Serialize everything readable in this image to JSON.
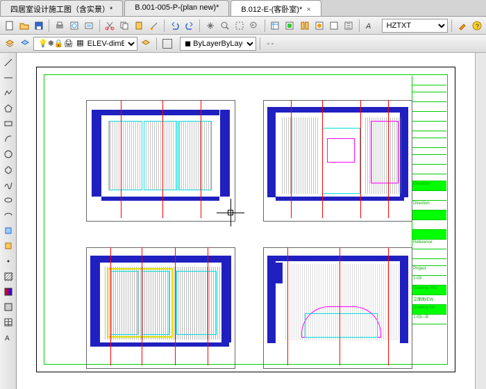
{
  "tabs": [
    {
      "label": "四居室设计施工图（含实景）*",
      "active": false
    },
    {
      "label": "B.001-005-P-(plan new)*",
      "active": false
    },
    {
      "label": "B.012-E-(客卧室)*",
      "active": true
    }
  ],
  "toolbar1": {
    "icons": [
      "new",
      "open",
      "save",
      "print",
      "preview",
      "cut",
      "copy",
      "paste",
      "match",
      "undo",
      "redo",
      "pan",
      "zoom",
      "zoomext",
      "prop",
      "sheet",
      "block",
      "tool",
      "help"
    ]
  },
  "toolbar2": {
    "layer_name": "ELEV-dim",
    "text_style": "HZTXT",
    "linetype": "ByLayer"
  },
  "side_tools": [
    "line",
    "pline",
    "polygon",
    "rect",
    "arc",
    "circle",
    "spline",
    "ellipse",
    "earc",
    "point",
    "hatch",
    "region",
    "table",
    "mtext",
    "wipeout",
    "rev"
  ],
  "title_block": {
    "rows": [
      {
        "label": "",
        "cls": ""
      },
      {
        "label": "",
        "cls": "blank"
      },
      {
        "label": "",
        "cls": ""
      },
      {
        "label": "",
        "cls": ""
      },
      {
        "label": "",
        "cls": ""
      },
      {
        "label": "",
        "cls": ""
      },
      {
        "label": "",
        "cls": "blank"
      },
      {
        "label": "",
        "cls": ""
      },
      {
        "label": "",
        "cls": "blank"
      },
      {
        "label": "",
        "cls": ""
      },
      {
        "label": "",
        "cls": ""
      },
      {
        "label": "",
        "cls": "blank"
      },
      {
        "label": "Elevation",
        "cls": "green"
      },
      {
        "label": "",
        "cls": ""
      },
      {
        "label": "Direction",
        "cls": ""
      },
      {
        "label": "",
        "cls": "green"
      },
      {
        "label": "",
        "cls": ""
      },
      {
        "label": "",
        "cls": "green"
      },
      {
        "label": "Reference",
        "cls": ""
      },
      {
        "label": "",
        "cls": ""
      },
      {
        "label": "",
        "cls": "blank"
      },
      {
        "label": "Project",
        "cls": ""
      },
      {
        "label": "1-03",
        "cls": ""
      },
      {
        "label": "Drawing Title",
        "cls": "green"
      },
      {
        "label": "立面图/EW",
        "cls": ""
      },
      {
        "label": "Drawing No.",
        "cls": "green"
      },
      {
        "label": "1-03—B",
        "cls": ""
      }
    ]
  },
  "colors": {
    "layer_swatch": "#ff0000"
  }
}
